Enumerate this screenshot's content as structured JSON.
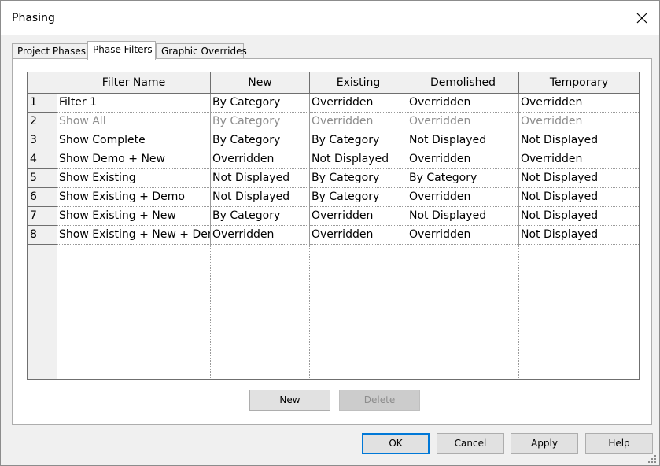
{
  "window": {
    "title": "Phasing"
  },
  "tabs": [
    {
      "label": "Project Phases",
      "active": false
    },
    {
      "label": "Phase Filters",
      "active": true
    },
    {
      "label": "Graphic Overrides",
      "active": false
    }
  ],
  "table": {
    "columns": [
      "Filter Name",
      "New",
      "Existing",
      "Demolished",
      "Temporary"
    ],
    "rows": [
      {
        "num": "1",
        "cells": [
          "Filter 1",
          "By Category",
          "Overridden",
          "Overridden",
          "Overridden"
        ]
      },
      {
        "num": "2",
        "cells": [
          "Show All",
          "By Category",
          "Overridden",
          "Overridden",
          "Overridden"
        ],
        "disabled": true
      },
      {
        "num": "3",
        "cells": [
          "Show Complete",
          "By Category",
          "By Category",
          "Not Displayed",
          "Not Displayed"
        ]
      },
      {
        "num": "4",
        "cells": [
          "Show Demo + New",
          "Overridden",
          "Not Displayed",
          "Overridden",
          "Overridden"
        ]
      },
      {
        "num": "5",
        "cells": [
          "Show Existing",
          "Not Displayed",
          "By Category",
          "By Category",
          "Not Displayed"
        ]
      },
      {
        "num": "6",
        "cells": [
          "Show Existing + Demo",
          "Not Displayed",
          "By Category",
          "Overridden",
          "Not Displayed"
        ]
      },
      {
        "num": "7",
        "cells": [
          "Show Existing + New",
          "By Category",
          "Overridden",
          "Not Displayed",
          "Not Displayed"
        ]
      },
      {
        "num": "8",
        "cells": [
          "Show Existing + New + Dem",
          "Overridden",
          "Overridden",
          "Overridden",
          "Not Displayed"
        ]
      }
    ]
  },
  "panel_buttons": {
    "new_label": "New",
    "delete_label": "Delete"
  },
  "footer_buttons": {
    "ok_label": "OK",
    "cancel_label": "Cancel",
    "apply_label": "Apply",
    "help_label": "Help"
  },
  "colors": {
    "default_button_border": "#0078d7",
    "disabled_text": "#8d8d8d"
  },
  "icons": {
    "close": "close-icon",
    "grip": "resize-grip-icon"
  }
}
